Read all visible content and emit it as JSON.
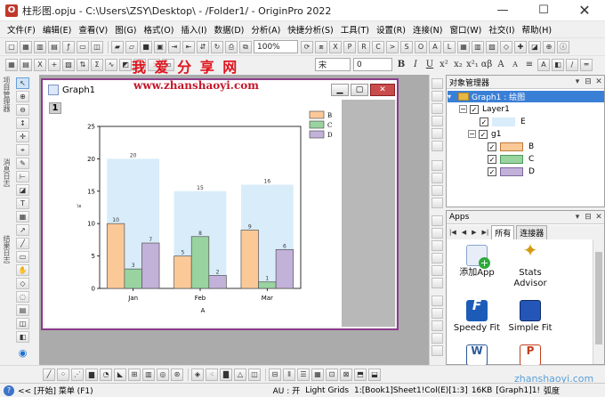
{
  "window": {
    "title": "柱形图.opju - C:\\Users\\ZSY\\Desktop\\ - /Folder1/ - OriginPro 2022",
    "app_icon": "origin-logo-icon"
  },
  "menu": [
    "文件(F)",
    "编辑(E)",
    "查看(V)",
    "图(G)",
    "格式(O)",
    "插入(I)",
    "数据(D)",
    "分析(A)",
    "快捷分析(S)",
    "工具(T)",
    "设置(R)",
    "连接(N)",
    "窗口(W)",
    "社交(I)",
    "帮助(H)"
  ],
  "toolbar": {
    "zoom": "100%",
    "font_name": "宋",
    "font_size": "0",
    "format_buttons": [
      "B",
      "I",
      "U",
      "x²",
      "x₂",
      "x²₁",
      "αβ",
      "A",
      "A",
      "≡"
    ]
  },
  "watermark": {
    "cn": "我 爱 分 享 网",
    "url": "www.zhanshaoyi.com",
    "url_bottom": "zhanshaoyi.com"
  },
  "left_labels": [
    "项目管理器",
    "消息日志",
    "结果日志"
  ],
  "graph_window": {
    "title": "Graph1",
    "layer": "1",
    "min": "▁",
    "max": "▢",
    "close": "✕"
  },
  "chart_data": {
    "type": "bar",
    "categories": [
      "Jan",
      "Feb",
      "Mar"
    ],
    "series": [
      {
        "name": "E",
        "values": [
          20,
          15,
          16
        ],
        "color": "#d8ecf9",
        "labels": [
          "20",
          "15",
          "16"
        ]
      },
      {
        "name": "B",
        "values": [
          10,
          5,
          9
        ],
        "color": "#fbc997",
        "labels": [
          "10",
          "5",
          "9"
        ]
      },
      {
        "name": "C",
        "values": [
          3,
          8,
          1
        ],
        "color": "#98d3a0",
        "labels": [
          "3",
          "8",
          "1"
        ]
      },
      {
        "name": "D",
        "values": [
          7,
          2,
          6
        ],
        "color": "#c2b1d8",
        "labels": [
          "7",
          "2",
          "6"
        ]
      }
    ],
    "legend": [
      "B",
      "C",
      "D"
    ],
    "legend_placement": "top-right",
    "xlabel": "A",
    "ylabel": "\\x",
    "ylim": [
      0,
      25
    ],
    "yticks": [
      "0",
      "5",
      "10",
      "15",
      "20",
      "25"
    ],
    "grid": false
  },
  "object_manager": {
    "title": "对象管理器",
    "buttons": [
      "▾",
      "⊟",
      "✕"
    ],
    "tree": {
      "root": "Graph1 : 绘图",
      "layer": "Layer1",
      "e_plot": "E",
      "group": "g1",
      "plots": [
        "B",
        "C",
        "D"
      ]
    }
  },
  "apps": {
    "title": "Apps",
    "tabs": [
      "所有",
      "连接器"
    ],
    "tiles": [
      {
        "label": "添加App",
        "icon": "add-app-icon"
      },
      {
        "label": "Stats Advisor",
        "icon": "wand-icon"
      },
      {
        "label": "Speedy Fit",
        "icon": "speedy-fit-icon"
      },
      {
        "label": "Simple Fit",
        "icon": "simple-fit-icon"
      },
      {
        "label": "",
        "icon": "word-icon"
      },
      {
        "label": "",
        "icon": "powerpoint-icon"
      }
    ]
  },
  "status": {
    "start": "<< [开始] 菜单 (F1)",
    "au": "AU : 开",
    "grids": "Light Grids",
    "cell": "1:[Book1]Sheet1!Col(E)[1:3]",
    "size": "16KB",
    "graph": "[Graph1]1!",
    "unit": "弧度"
  }
}
